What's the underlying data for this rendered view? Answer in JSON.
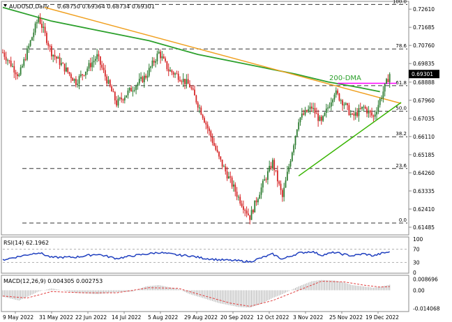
{
  "chart_data": [
    {
      "type": "candlestick",
      "header": {
        "symbol_timeframe": "AUDUSD,Daily",
        "ohlc": "0.68750 0.69364 0.68734 0.69301"
      },
      "price_axis_ticks": [
        "0.72610",
        "0.71685",
        "0.70760",
        "0.69835",
        "0.68888",
        "0.67960",
        "0.67035",
        "0.66110",
        "0.65185",
        "0.64260",
        "0.63335",
        "0.62410",
        "0.61485"
      ],
      "ylim": [
        0.612,
        0.729
      ],
      "current_price_label": "0.69301",
      "fibonacci": [
        {
          "label": "100.0",
          "price": 0.7285
        },
        {
          "label": "78.6",
          "price": 0.7058
        },
        {
          "label": "61.8",
          "price": 0.6871
        },
        {
          "label": "50.0",
          "price": 0.674
        },
        {
          "label": "38.2",
          "price": 0.661
        },
        {
          "label": "23.6",
          "price": 0.6448
        },
        {
          "label": "0.0",
          "price": 0.617
        }
      ],
      "annotation": "200-DMA",
      "x_tick_labels": [
        "9 May 2022",
        "31 May 2022",
        "22 Jun 2022",
        "14 Jul 2022",
        "5 Aug 2022",
        "29 Aug 2022",
        "20 Sep 2022",
        "12 Oct 2022",
        "3 Nov 2022",
        "25 Nov 2022",
        "19 Dec 2022"
      ],
      "key_points": [
        {
          "t": 0,
          "price": 0.704
        },
        {
          "t": 10,
          "price": 0.692
        },
        {
          "t": 22,
          "price": 0.722
        },
        {
          "t": 30,
          "price": 0.704
        },
        {
          "t": 45,
          "price": 0.689
        },
        {
          "t": 58,
          "price": 0.702
        },
        {
          "t": 70,
          "price": 0.678
        },
        {
          "t": 80,
          "price": 0.686
        },
        {
          "t": 88,
          "price": 0.692
        },
        {
          "t": 96,
          "price": 0.704
        },
        {
          "t": 102,
          "price": 0.695
        },
        {
          "t": 108,
          "price": 0.692
        },
        {
          "t": 115,
          "price": 0.687
        },
        {
          "t": 123,
          "price": 0.672
        },
        {
          "t": 133,
          "price": 0.65
        },
        {
          "t": 145,
          "price": 0.63
        },
        {
          "t": 152,
          "price": 0.62
        },
        {
          "t": 158,
          "price": 0.633
        },
        {
          "t": 166,
          "price": 0.648
        },
        {
          "t": 172,
          "price": 0.63
        },
        {
          "t": 182,
          "price": 0.67
        },
        {
          "t": 190,
          "price": 0.676
        },
        {
          "t": 196,
          "price": 0.668
        },
        {
          "t": 204,
          "price": 0.684
        },
        {
          "t": 210,
          "price": 0.678
        },
        {
          "t": 215,
          "price": 0.671
        },
        {
          "t": 222,
          "price": 0.676
        },
        {
          "t": 228,
          "price": 0.671
        },
        {
          "t": 233,
          "price": 0.682
        },
        {
          "t": 238,
          "price": 0.693
        }
      ],
      "dma_points": [
        {
          "t": 0,
          "price": 0.727
        },
        {
          "t": 30,
          "price": 0.72
        },
        {
          "t": 60,
          "price": 0.715
        },
        {
          "t": 90,
          "price": 0.71
        },
        {
          "t": 120,
          "price": 0.703
        },
        {
          "t": 150,
          "price": 0.698
        },
        {
          "t": 180,
          "price": 0.693
        },
        {
          "t": 200,
          "price": 0.689
        },
        {
          "t": 220,
          "price": 0.686
        },
        {
          "t": 232,
          "price": 0.684
        }
      ],
      "resistance_line": [
        {
          "t": 0,
          "price": 0.727
        },
        {
          "t": 245,
          "price": 0.678
        }
      ],
      "support_line": [
        {
          "t": 182,
          "price": 0.641
        },
        {
          "t": 245,
          "price": 0.6785
        }
      ],
      "horizontal_resistance": [
        {
          "t": 206,
          "price": 0.6883
        },
        {
          "t": 240,
          "price": 0.6883
        }
      ]
    },
    {
      "type": "line",
      "title": "RSI(14) 62.1962",
      "ylim": [
        0,
        100
      ],
      "ticks": [
        "100",
        "70",
        "30",
        "0"
      ],
      "levels": [
        70,
        30
      ],
      "rsi_points": [
        {
          "t": 0,
          "v": 38
        },
        {
          "t": 10,
          "v": 48
        },
        {
          "t": 22,
          "v": 60
        },
        {
          "t": 30,
          "v": 45
        },
        {
          "t": 45,
          "v": 46
        },
        {
          "t": 58,
          "v": 55
        },
        {
          "t": 70,
          "v": 42
        },
        {
          "t": 80,
          "v": 50
        },
        {
          "t": 88,
          "v": 55
        },
        {
          "t": 96,
          "v": 60
        },
        {
          "t": 108,
          "v": 52
        },
        {
          "t": 115,
          "v": 50
        },
        {
          "t": 123,
          "v": 43
        },
        {
          "t": 133,
          "v": 38
        },
        {
          "t": 145,
          "v": 35
        },
        {
          "t": 152,
          "v": 32
        },
        {
          "t": 158,
          "v": 42
        },
        {
          "t": 166,
          "v": 55
        },
        {
          "t": 172,
          "v": 40
        },
        {
          "t": 182,
          "v": 58
        },
        {
          "t": 190,
          "v": 63
        },
        {
          "t": 196,
          "v": 52
        },
        {
          "t": 204,
          "v": 60
        },
        {
          "t": 210,
          "v": 54
        },
        {
          "t": 215,
          "v": 50
        },
        {
          "t": 222,
          "v": 56
        },
        {
          "t": 228,
          "v": 50
        },
        {
          "t": 233,
          "v": 57
        },
        {
          "t": 238,
          "v": 62
        }
      ]
    },
    {
      "type": "bar",
      "title": "MACD(12,26,9) 0.004305 0.002753",
      "ylim": [
        -0.016,
        0.01
      ],
      "ticks": [
        "0.008696",
        "0.00",
        "-0.014068"
      ],
      "macd_points": [
        {
          "t": 0,
          "v": -0.005
        },
        {
          "t": 10,
          "v": -0.008
        },
        {
          "t": 22,
          "v": -0.001
        },
        {
          "t": 30,
          "v": 0.0015
        },
        {
          "t": 45,
          "v": -0.002
        },
        {
          "t": 58,
          "v": -0.003
        },
        {
          "t": 70,
          "v": -0.0015
        },
        {
          "t": 80,
          "v": -0.001
        },
        {
          "t": 88,
          "v": 0.003
        },
        {
          "t": 96,
          "v": 0.004
        },
        {
          "t": 108,
          "v": 0.001
        },
        {
          "t": 115,
          "v": -0.003
        },
        {
          "t": 123,
          "v": -0.006
        },
        {
          "t": 133,
          "v": -0.01
        },
        {
          "t": 145,
          "v": -0.013
        },
        {
          "t": 152,
          "v": -0.0135
        },
        {
          "t": 158,
          "v": -0.011
        },
        {
          "t": 166,
          "v": -0.006
        },
        {
          "t": 172,
          "v": -0.003
        },
        {
          "t": 182,
          "v": 0.003
        },
        {
          "t": 190,
          "v": 0.007
        },
        {
          "t": 196,
          "v": 0.008
        },
        {
          "t": 204,
          "v": 0.0075
        },
        {
          "t": 210,
          "v": 0.006
        },
        {
          "t": 215,
          "v": 0.004
        },
        {
          "t": 222,
          "v": 0.003
        },
        {
          "t": 228,
          "v": 0.002
        },
        {
          "t": 233,
          "v": 0.003
        },
        {
          "t": 238,
          "v": 0.0043
        }
      ],
      "signal_points": [
        {
          "t": 0,
          "v": -0.0045
        },
        {
          "t": 15,
          "v": -0.006
        },
        {
          "t": 30,
          "v": -0.001
        },
        {
          "t": 50,
          "v": -0.002
        },
        {
          "t": 70,
          "v": -0.002
        },
        {
          "t": 90,
          "v": 0.002
        },
        {
          "t": 108,
          "v": 0.0015
        },
        {
          "t": 123,
          "v": -0.004
        },
        {
          "t": 140,
          "v": -0.01
        },
        {
          "t": 152,
          "v": -0.0125
        },
        {
          "t": 166,
          "v": -0.008
        },
        {
          "t": 182,
          "v": 0.0
        },
        {
          "t": 196,
          "v": 0.007
        },
        {
          "t": 210,
          "v": 0.0065
        },
        {
          "t": 222,
          "v": 0.004
        },
        {
          "t": 232,
          "v": 0.0025
        },
        {
          "t": 238,
          "v": 0.0028
        }
      ]
    }
  ],
  "colors": {
    "bull": "#2e7d32",
    "bear": "#d62728",
    "dma": "#2ca02c",
    "resistance": "#f0a020",
    "support": "#37b400",
    "magenta": "#ff00ff",
    "rsi": "#1f3fbf",
    "macd_hist": "#b0b0b0",
    "signal": "#e04040"
  }
}
